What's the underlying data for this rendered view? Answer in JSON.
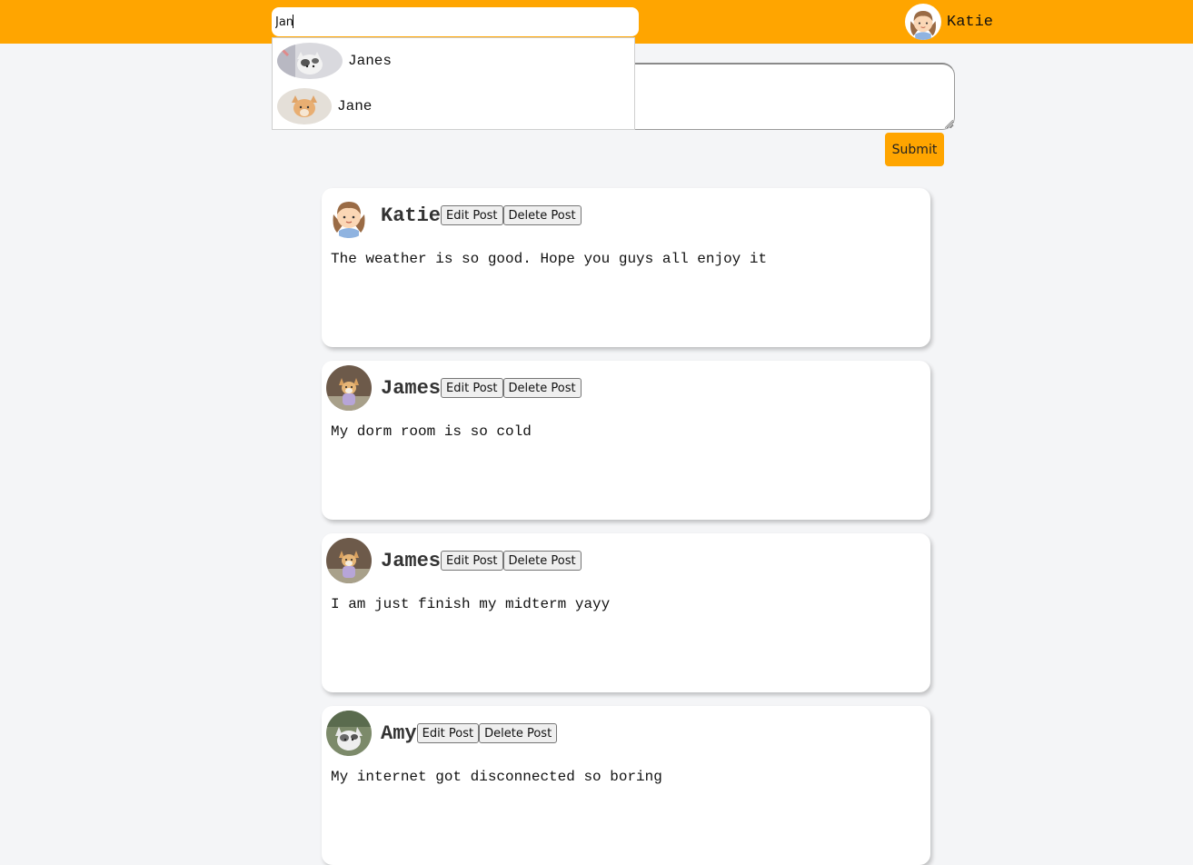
{
  "header": {
    "search": {
      "value": "Jan",
      "placeholder": ""
    },
    "current_user": {
      "name": "Katie",
      "avatar_icon": "girl-avatar-icon"
    }
  },
  "search_results": [
    {
      "label": "Janes",
      "thumb_icon": "cat-photo-icon"
    },
    {
      "label": "Jane",
      "thumb_icon": "orange-cat-photo-icon"
    }
  ],
  "composer": {
    "value": "",
    "submit_label": "Submit"
  },
  "posts": [
    {
      "author": "Katie",
      "avatar_icon": "girl-avatar-icon",
      "edit_label": "Edit Post",
      "delete_label": "Delete Post",
      "body": "The weather is so good. Hope you guys all enjoy it"
    },
    {
      "author": "James",
      "avatar_icon": "corgi-photo-icon",
      "edit_label": "Edit Post",
      "delete_label": "Delete Post",
      "body": "My dorm room is so cold"
    },
    {
      "author": "James",
      "avatar_icon": "corgi-photo-icon",
      "edit_label": "Edit Post",
      "delete_label": "Delete Post",
      "body": "I am just finish my midterm yayy"
    },
    {
      "author": "Amy",
      "avatar_icon": "cat-photo-icon",
      "edit_label": "Edit Post",
      "delete_label": "Delete Post",
      "body": "My internet got disconnected so boring"
    }
  ],
  "colors": {
    "topbar": "#ffa500",
    "submit": "#ffa500",
    "page_background": "#f4f5f7"
  }
}
